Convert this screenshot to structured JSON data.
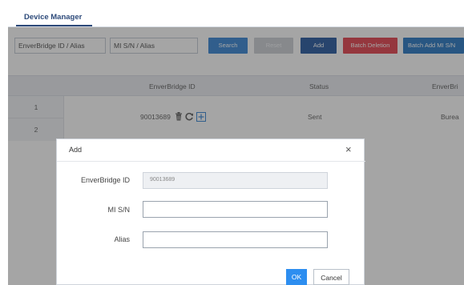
{
  "tabs": {
    "device_manager": "Device Manager"
  },
  "toolbar": {
    "enverbridge_placeholder": "EnverBridge ID / Alias",
    "misn_placeholder": "MI S/N / Alias",
    "search_label": "Search",
    "reset_label": "Reset",
    "add_label": "Add",
    "batch_deletion_label": "Batch Deletion",
    "batch_add_label": "Batch Add MI S/N"
  },
  "table": {
    "headers": {
      "enverbridge_id": "EnverBridge ID",
      "status": "Status",
      "enverbridge_cut": "EnverBri"
    },
    "rows": [
      "1",
      "2"
    ],
    "entry": {
      "enverbridge_id": "90013689",
      "status": "Sent",
      "location_cut": "Burea"
    }
  },
  "dialog": {
    "title": "Add",
    "close_symbol": "×",
    "enverbridge_label": "EnverBridge ID",
    "enverbridge_value": "90013689",
    "misn_label": "MI S/N",
    "misn_value": "",
    "alias_label": "Alias",
    "alias_value": "",
    "ok_label": "OK",
    "cancel_label": "Cancel"
  },
  "colors": {
    "search": "#2c7fd1",
    "add": "#1a4f99",
    "batch_deletion": "#e23744",
    "batch_add": "#1d6fbf",
    "ok": "#2d8ef0"
  },
  "icons": [
    "trash-icon",
    "refresh-icon",
    "plus-box-icon",
    "close-icon"
  ]
}
